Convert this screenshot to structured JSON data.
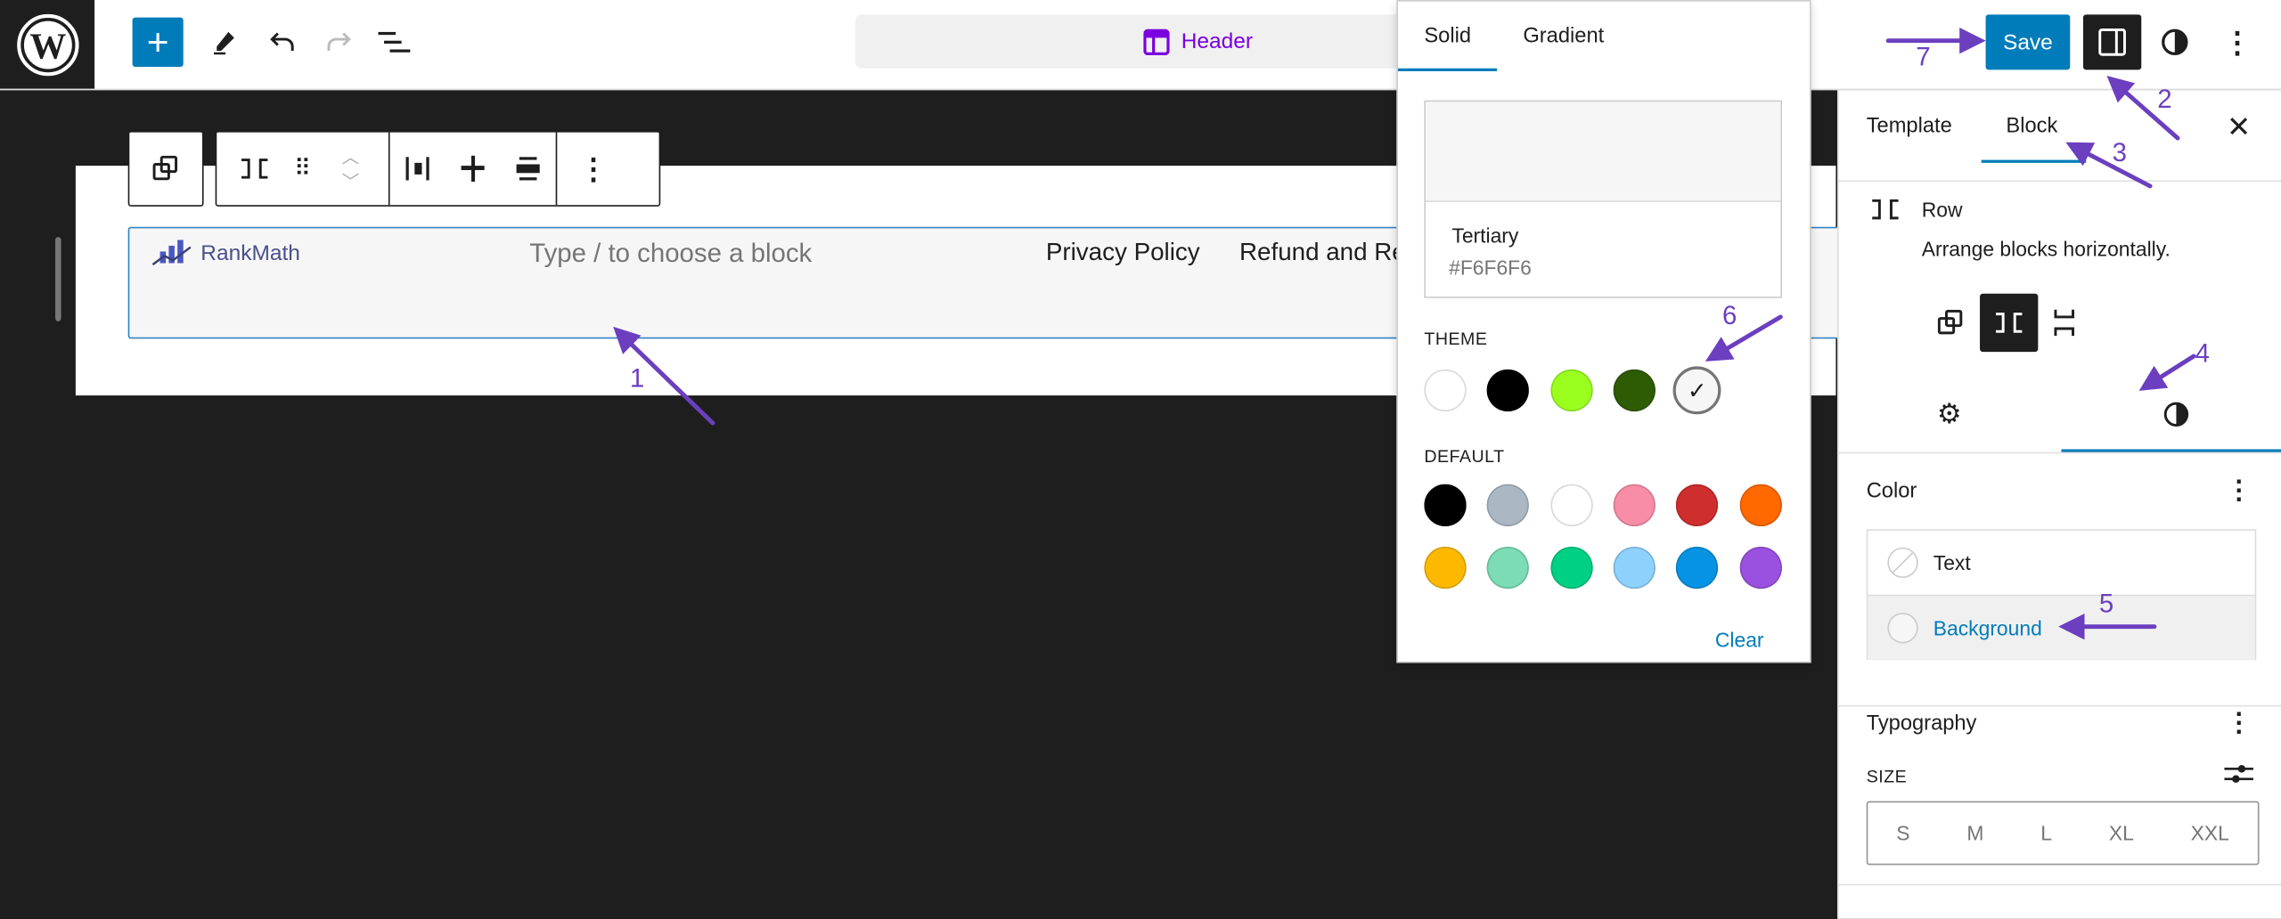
{
  "topbar": {
    "add_label": "+",
    "document_title": "Header",
    "save_label": "Save",
    "icons": [
      "wordpress-logo",
      "plus-icon",
      "pencil-icon",
      "undo-icon",
      "redo-icon",
      "list-view-icon",
      "layout-icon",
      "sidebar-icon",
      "half-circle-icon",
      "more-vertical-icon"
    ]
  },
  "canvas": {
    "logo_text": "RankMath",
    "placeholder": "Type / to choose a block",
    "nav_items": [
      "Privacy Policy",
      "Refund and Re"
    ]
  },
  "color_popover": {
    "tabs": [
      "Solid",
      "Gradient"
    ],
    "active_tab": "Solid",
    "selected_name": "Tertiary",
    "selected_hex": "#F6F6F6",
    "theme_label": "THEME",
    "theme_colors": [
      "#FFFFFF",
      "#000000",
      "#9AFF1F",
      "#2E5C05",
      "#F6F6F6"
    ],
    "default_label": "DEFAULT",
    "default_colors": [
      "#000000",
      "#ABB8C3",
      "#FFFFFF",
      "#F78DA7",
      "#CF2E2E",
      "#FF6900",
      "#FCB900",
      "#7BDCB5",
      "#00D084",
      "#8ED1FC",
      "#0693E3",
      "#9B51E0"
    ],
    "clear_label": "Clear"
  },
  "sidebar": {
    "tabs": [
      "Template",
      "Block"
    ],
    "active_tab": "Block",
    "block_name": "Row",
    "block_description": "Arrange blocks horizontally.",
    "color_heading": "Color",
    "color_items": [
      "Text",
      "Background"
    ],
    "typography_heading": "Typography",
    "size_label": "SIZE",
    "sizes": [
      "S",
      "M",
      "L",
      "XL",
      "XXL"
    ]
  },
  "annotations": [
    "1",
    "2",
    "3",
    "4",
    "5",
    "6",
    "7"
  ],
  "colors": {
    "accent": "#007cba",
    "annotation": "#6b3fbf",
    "template_purple": "#7a00df"
  }
}
